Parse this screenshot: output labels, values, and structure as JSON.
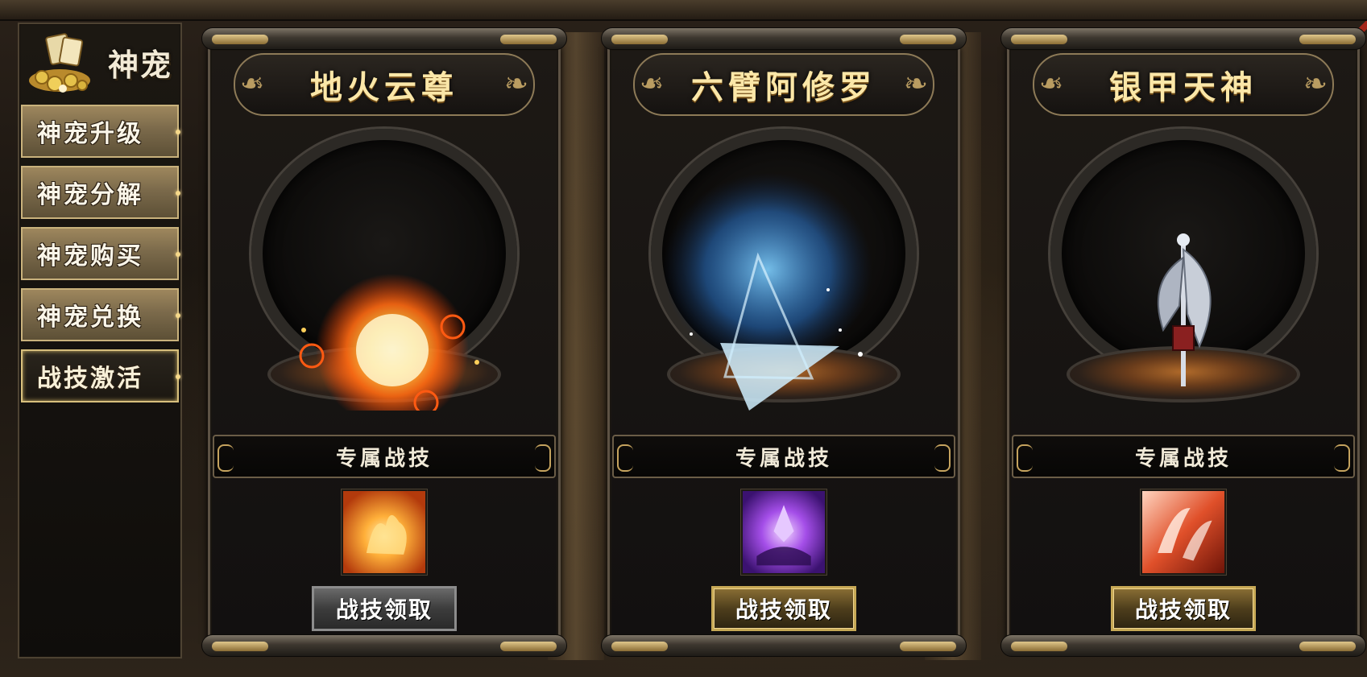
{
  "sidebar": {
    "title": "神宠",
    "items": [
      {
        "label": "神宠升级",
        "active": false
      },
      {
        "label": "神宠分解",
        "active": false
      },
      {
        "label": "神宠购买",
        "active": false
      },
      {
        "label": "神宠兑换",
        "active": false
      },
      {
        "label": "战技激活",
        "active": true
      }
    ]
  },
  "cards": [
    {
      "name": "地火云尊",
      "skill_title": "专属战技",
      "button_label": "战技领取",
      "button_style": "gray",
      "effect": "fire-orb",
      "skill_icon": "fire-burst-icon"
    },
    {
      "name": "六臂阿修罗",
      "skill_title": "专属战技",
      "button_label": "战技领取",
      "button_style": "gold",
      "effect": "ice-triangle",
      "skill_icon": "purple-crystal-icon"
    },
    {
      "name": "银甲天神",
      "skill_title": "专属战技",
      "button_label": "战技领取",
      "button_style": "gold",
      "effect": "silver-blade",
      "skill_icon": "red-slash-icon"
    }
  ],
  "colors": {
    "gold_text": "#fbe7a8",
    "frame": "#5d5244",
    "sidebar_button": "#9e875d",
    "accent_red": "#a3261a"
  }
}
